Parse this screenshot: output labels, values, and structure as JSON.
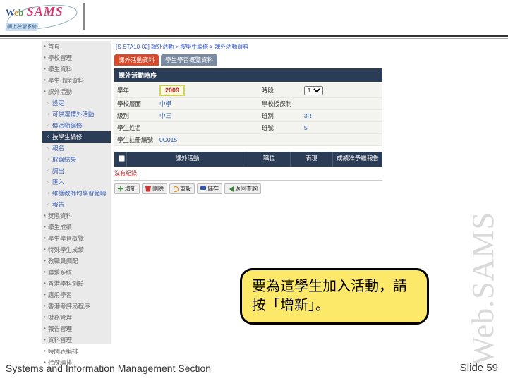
{
  "logo": {
    "web_w": "W",
    "web_e": "e",
    "web_b": "b",
    "sams": "SAMS",
    "sub": "網上校管系統"
  },
  "sidebar": {
    "items": [
      {
        "label": "首頁",
        "sub": false
      },
      {
        "label": "學校管理",
        "sub": false
      },
      {
        "label": "學生資料",
        "sub": false
      },
      {
        "label": "學生出席資料",
        "sub": false
      },
      {
        "label": "課外活動",
        "sub": false
      },
      {
        "label": "設定",
        "sub": true
      },
      {
        "label": "可供選擇外活動",
        "sub": true
      },
      {
        "label": "俱活動編修",
        "sub": true
      },
      {
        "label": "按學生編修",
        "sub": true,
        "active": true
      },
      {
        "label": "報名",
        "sub": true
      },
      {
        "label": "取錄結果",
        "sub": true
      },
      {
        "label": "調出",
        "sub": true
      },
      {
        "label": "匯入",
        "sub": true
      },
      {
        "label": "維護教師均學習範疇",
        "sub": true
      },
      {
        "label": "報告",
        "sub": true
      },
      {
        "label": "獎懲資料",
        "sub": false
      },
      {
        "label": "學生成績",
        "sub": false
      },
      {
        "label": "學生學習概覽",
        "sub": false
      },
      {
        "label": "特殊學生成績",
        "sub": false
      },
      {
        "label": "教職員調配",
        "sub": false
      },
      {
        "label": "聯繫系統",
        "sub": false
      },
      {
        "label": "香港學科測驗",
        "sub": false
      },
      {
        "label": "應用學習",
        "sub": false
      },
      {
        "label": "香港考評局程序",
        "sub": false
      },
      {
        "label": "財務管理",
        "sub": false
      },
      {
        "label": "報告管理",
        "sub": false
      },
      {
        "label": "資料管理",
        "sub": false
      },
      {
        "label": "時間表編排",
        "sub": false
      },
      {
        "label": "代課編排",
        "sub": false
      }
    ]
  },
  "breadcrumb": "[S-STA10-02] 課外活動 > 按學生編修 > 課外活動資料",
  "tabs": [
    {
      "label": "課外活動資料",
      "active": true
    },
    {
      "label": "學生學習概覽資料",
      "active": false
    }
  ],
  "section_title": "課外活動時序",
  "form": {
    "rows": [
      {
        "label": "學年",
        "value": "2009",
        "highlight": true,
        "r_label": "時段",
        "r_select": [
          "1"
        ]
      },
      {
        "label": "學校層面",
        "value": "中學",
        "r_label": "學校授課制",
        "r_value": ""
      },
      {
        "label": "級別",
        "value": "中三",
        "r_label": "班別",
        "r_value": "3R"
      },
      {
        "label": "學生姓名",
        "value": "",
        "r_label": "班號",
        "r_value": "5"
      },
      {
        "label": "學生註冊編號",
        "value": "0C015",
        "r_label": "",
        "r_value": ""
      }
    ]
  },
  "grid": {
    "cols": [
      "",
      "課外活動",
      "職位",
      "表現",
      "成績准予繼報告"
    ],
    "note": "沒有紀錄"
  },
  "buttons": [
    "增新",
    "刪除",
    "重設",
    "儲存",
    "返回查詢"
  ],
  "callout": "要為這學生加入活動，請按「增新」。",
  "watermark": "Web.SAMS",
  "footer": {
    "left": "Systems and Information Management Section",
    "right_label": "Slide",
    "right_num": "59"
  }
}
